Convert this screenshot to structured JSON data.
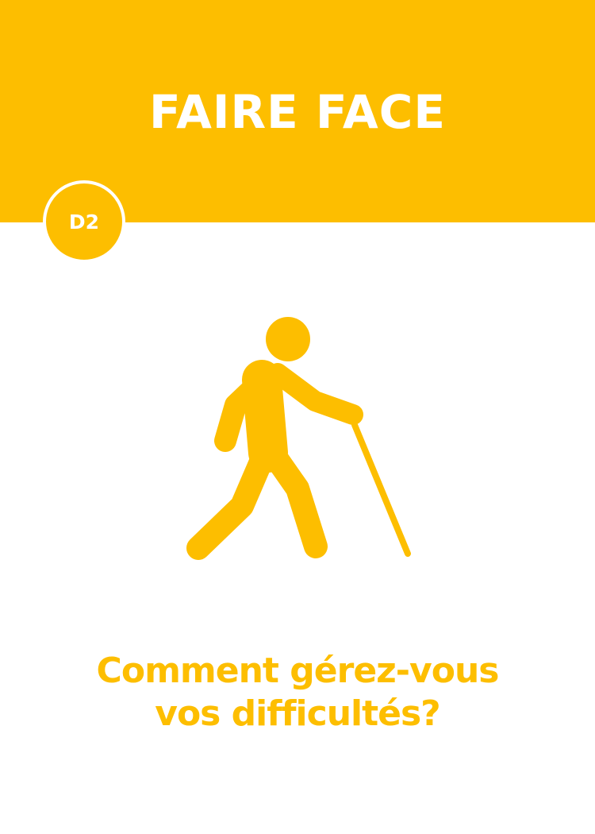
{
  "card": {
    "title": "FAIRE FACE",
    "badge": "D2",
    "icon": "person-walking-with-cane-icon",
    "question_lines": [
      "Comment gérez-vous",
      "vos difficultés?"
    ]
  },
  "colors": {
    "accent": "#FDBE00",
    "text_on_accent": "#ffffff",
    "background": "#ffffff"
  }
}
